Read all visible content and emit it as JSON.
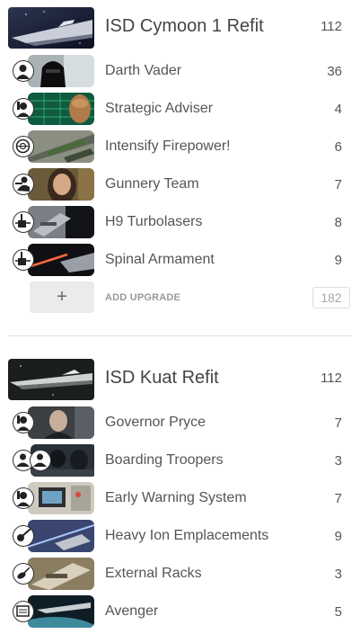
{
  "ships": [
    {
      "name": "ISD Cymoon 1 Refit",
      "points": "112",
      "thumb_icon": "star-destroyer-image",
      "upgrades": [
        {
          "name": "Darth Vader",
          "points": "36",
          "type_icon": "commander-icon",
          "image": "vader-portrait"
        },
        {
          "name": "Strategic Adviser",
          "points": "4",
          "type_icon": "officer-icon",
          "image": "adviser-portrait"
        },
        {
          "name": "Intensify Firepower!",
          "points": "6",
          "type_icon": "fleet-command-icon",
          "image": "cannons-image"
        },
        {
          "name": "Gunnery Team",
          "points": "7",
          "type_icon": "weapons-team-icon",
          "image": "gunner-portrait"
        },
        {
          "name": "H9 Turbolasers",
          "points": "8",
          "type_icon": "turbolaser-icon",
          "image": "turbolaser-image"
        },
        {
          "name": "Spinal Armament",
          "points": "9",
          "type_icon": "turbolaser-icon",
          "image": "laser-beam-image"
        }
      ],
      "add_label": "ADD UPGRADE",
      "add_symbol": "+",
      "total": "182"
    },
    {
      "name": "ISD Kuat Refit",
      "points": "112",
      "thumb_icon": "star-destroyer-image",
      "upgrades": [
        {
          "name": "Governor Pryce",
          "points": "7",
          "type_icon": "officer-icon",
          "image": "pryce-portrait"
        },
        {
          "name": "Boarding Troopers",
          "points": "3",
          "type_icon": "offensive-retrofit-icon",
          "image": "troopers-image"
        },
        {
          "name": "Early Warning System",
          "points": "7",
          "type_icon": "officer-icon",
          "image": "console-image"
        },
        {
          "name": "Heavy Ion Emplacements",
          "points": "9",
          "type_icon": "ion-cannon-icon",
          "image": "ion-image"
        },
        {
          "name": "External Racks",
          "points": "3",
          "type_icon": "ordnance-icon",
          "image": "racks-image"
        },
        {
          "name": "Avenger",
          "points": "5",
          "type_icon": "title-icon",
          "image": "avenger-image"
        }
      ]
    }
  ],
  "colors": {
    "text": "#555555",
    "add_button_bg": "#ebebeb",
    "add_label": "#999999",
    "total_text": "#aaaaaa",
    "divider": "#e3e3e3"
  }
}
